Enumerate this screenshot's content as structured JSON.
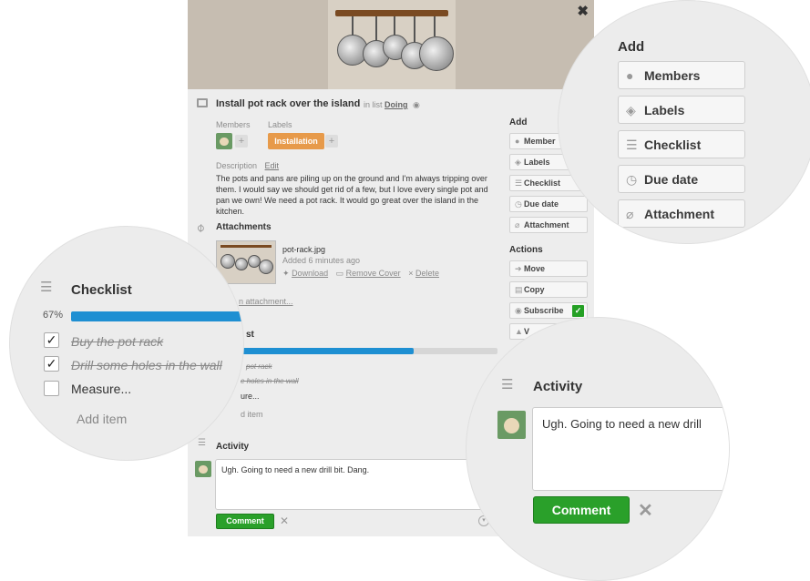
{
  "card": {
    "title": "Install pot rack over the island",
    "in_list_prefix": "in list",
    "list_name": "Doing",
    "members_label": "Members",
    "labels_label": "Labels",
    "label_tag": "Installation",
    "description_label": "Description",
    "description_edit": "Edit",
    "description_text": "The pots and pans are piling up on the ground and I'm always tripping over them. I would say we should get rid of a few, but I love every single pot and pan we own! We need a pot rack. It would go great over the island in the kitchen.",
    "attachments_title": "Attachments",
    "attachment": {
      "filename": "pot-rack.jpg",
      "added": "Added 6 minutes ago",
      "download": "Download",
      "remove_cover": "Remove Cover",
      "delete": "Delete"
    },
    "add_attachment_partial": "n attachment...",
    "checklist_title_partial": "st",
    "checklist_items_partial": [
      "pot rack",
      "e holes in the wall",
      "ure..."
    ],
    "add_item_partial": "d item",
    "activity_title": "Activity",
    "comment_text": "Ugh. Going to need a new drill bit. Dang.",
    "comment_button": "Comment",
    "close_symbol": "✖"
  },
  "sidebar": {
    "add_title": "Add",
    "add_buttons": [
      "Member",
      "Labels",
      "Checklist",
      "Due date",
      "Attachment"
    ],
    "actions_title": "Actions",
    "action_buttons": [
      "Move",
      "Copy",
      "Subscribe",
      "V"
    ]
  },
  "zoom_add": {
    "title": "Add",
    "buttons": [
      "Members",
      "Labels",
      "Checklist",
      "Due date",
      "Attachment"
    ]
  },
  "zoom_checklist": {
    "title": "Checklist",
    "percent": "67%",
    "progress": 0.67,
    "items": [
      {
        "text": "Buy the pot rack",
        "checked": true
      },
      {
        "text": "Drill some holes in the wall",
        "checked": true
      },
      {
        "text": "Measure...",
        "checked": false
      }
    ],
    "add_item": "Add item"
  },
  "zoom_activity": {
    "title": "Activity",
    "comment_text": "Ugh. Going to need a new drill",
    "comment_button": "Comment"
  },
  "colors": {
    "label_orange": "#e79a4a",
    "progress_blue": "#1e8fd2",
    "comment_green": "#2aa02a",
    "subscribe_check": "#24a024"
  },
  "icons": {
    "close": "close-icon",
    "card": "card-icon",
    "paperclip": "paperclip-icon",
    "checklist": "checklist-icon",
    "activity": "activity-icon"
  }
}
